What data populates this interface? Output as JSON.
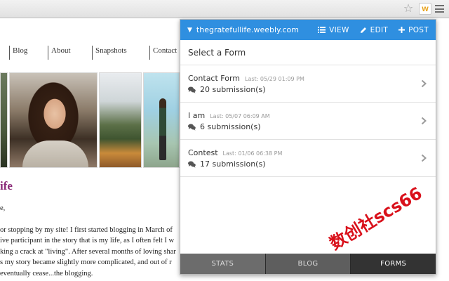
{
  "browser": {
    "star_glyph": "☆",
    "extension_letter": "w"
  },
  "website": {
    "nav": [
      "Blog",
      "About",
      "Snapshots",
      "Contact"
    ],
    "post_title": "ife",
    "post_lines": [
      "e,",
      "or stopping by my site!  I first started blogging in March of",
      "ive participant in the story that is my life, as I often felt I w",
      "king a crack at \"living\".  After several months of loving shar",
      "s my story became slightly more complicated, and out of r",
      "eventually cease...the blogging."
    ]
  },
  "popup": {
    "site": "thegratefullife.weebly.com",
    "actions": {
      "view": "VIEW",
      "edit": "EDIT",
      "post": "POST"
    },
    "section_title": "Select a Form",
    "forms": [
      {
        "name": "Contact Form",
        "last": "Last: 05/29 01:09 PM",
        "submissions": "20 submission(s)"
      },
      {
        "name": "I am",
        "last": "Last: 05/07 06:09 AM",
        "submissions": "6 submission(s)"
      },
      {
        "name": "Contest",
        "last": "Last: 01/06 06:38 PM",
        "submissions": "17 submission(s)"
      }
    ],
    "tabs": {
      "stats": "STATS",
      "blog": "BLOG",
      "forms": "FORMS"
    },
    "colors": {
      "header_blue": "#2f8fe0",
      "tab_bar": "#3a3a3a"
    }
  },
  "watermark": "数创社scs66"
}
